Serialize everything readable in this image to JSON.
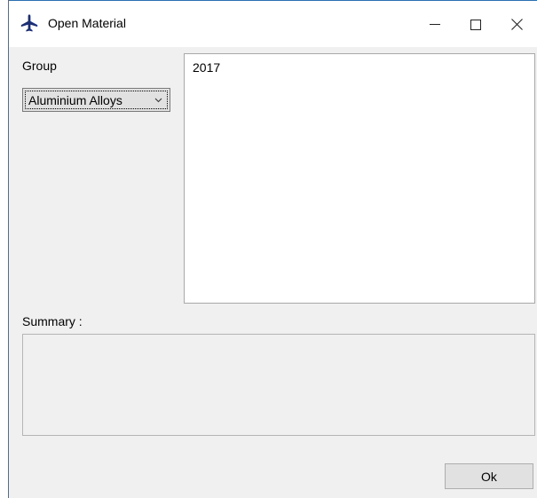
{
  "window": {
    "title": "Open Material",
    "icon": "airplane-icon",
    "controls": {
      "minimize": "minimize-icon",
      "maximize": "maximize-icon",
      "close": "close-icon"
    }
  },
  "group": {
    "label": "Group",
    "selected": "Aluminium Alloys"
  },
  "materials": {
    "items": [
      "2017"
    ]
  },
  "summary": {
    "label": "Summary :",
    "value": ""
  },
  "ok_button": {
    "label": "Ok"
  },
  "colors": {
    "window_bg": "#f0f0f0",
    "titlebar_bg": "#ffffff",
    "icon_blue": "#1c2f73"
  }
}
